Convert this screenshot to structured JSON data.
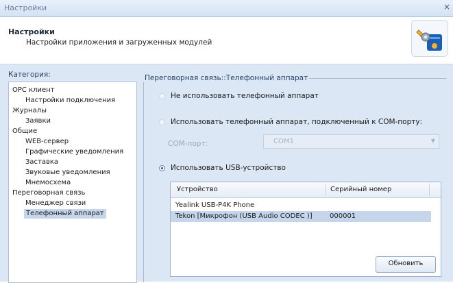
{
  "window": {
    "title": "Настройки",
    "close_glyph": "×"
  },
  "header": {
    "title": "Настройки",
    "subtitle": "Настройки приложения и загруженных модулей",
    "icon": "settings-wrench-icon"
  },
  "categories": {
    "label": "Категория:",
    "items": [
      {
        "label": "OPC клиент",
        "level": 0
      },
      {
        "label": "Настройки подключения",
        "level": 1
      },
      {
        "label": "Журналы",
        "level": 0
      },
      {
        "label": "Заявки",
        "level": 1
      },
      {
        "label": "Общие",
        "level": 0
      },
      {
        "label": "WEB-сервер",
        "level": 1
      },
      {
        "label": "Графические уведомления",
        "level": 1
      },
      {
        "label": "Заставка",
        "level": 1
      },
      {
        "label": "Звуковые уведомления",
        "level": 1
      },
      {
        "label": "Мнемосхема",
        "level": 1
      },
      {
        "label": "Переговорная связь",
        "level": 0
      },
      {
        "label": "Менеджер связи",
        "level": 1
      },
      {
        "label": "Телефонный аппарат",
        "level": 1,
        "selected": true
      }
    ]
  },
  "panel": {
    "title": "Переговорная связь::Телефонный аппарат",
    "options": [
      {
        "label": "Не использовать телефонный аппарат",
        "checked": false
      },
      {
        "label": "Использовать телефонный аппарат, подключенный к COM-порту:",
        "checked": false
      },
      {
        "label": "Использовать USB-устройство",
        "checked": true
      }
    ],
    "com_port": {
      "label": "COM-порт:",
      "value": "COM1",
      "enabled": false
    },
    "devices": {
      "columns": [
        "Устройство",
        "Серийный номер"
      ],
      "rows": [
        {
          "device": "Yealink USB-P4K Phone",
          "serial": ""
        },
        {
          "device": "Tekon [Микрофон (USB Audio CODEC )]",
          "serial": "000001",
          "selected": true
        }
      ]
    },
    "refresh_label": "Обновить"
  },
  "colors": {
    "panel_bg": "#dce7f5",
    "selection": "#c4d5ec",
    "title_text": "#2a3f66"
  }
}
